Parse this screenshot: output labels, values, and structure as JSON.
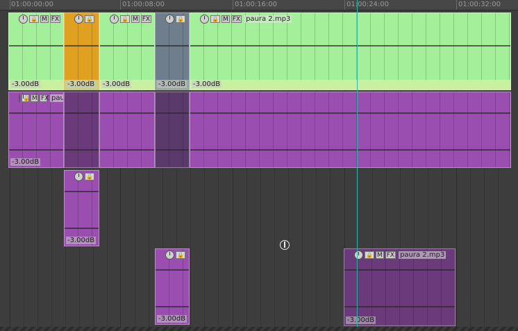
{
  "ruler": {
    "labels": [
      "01:00:00:00",
      "01:00:08:00",
      "01:00:16:00",
      "01:00:24:00",
      "01:00:32:00"
    ]
  },
  "items": {
    "btn_m": "M",
    "btn_fx": "FX",
    "lock_glyph": "🔒",
    "take_name": "paura 2.mp3",
    "volume": "-3.00dB"
  },
  "colors": {
    "track1_green": "#a4f09a",
    "track1_footer": "#c8f0a0",
    "orange": "#e0a020",
    "grey_blue": "#6e7e8c",
    "purple": "#9a4fb0",
    "purple_dark": "#6a3a7a",
    "background": "#3d3d3d",
    "playhead": "#2fb7a6"
  }
}
